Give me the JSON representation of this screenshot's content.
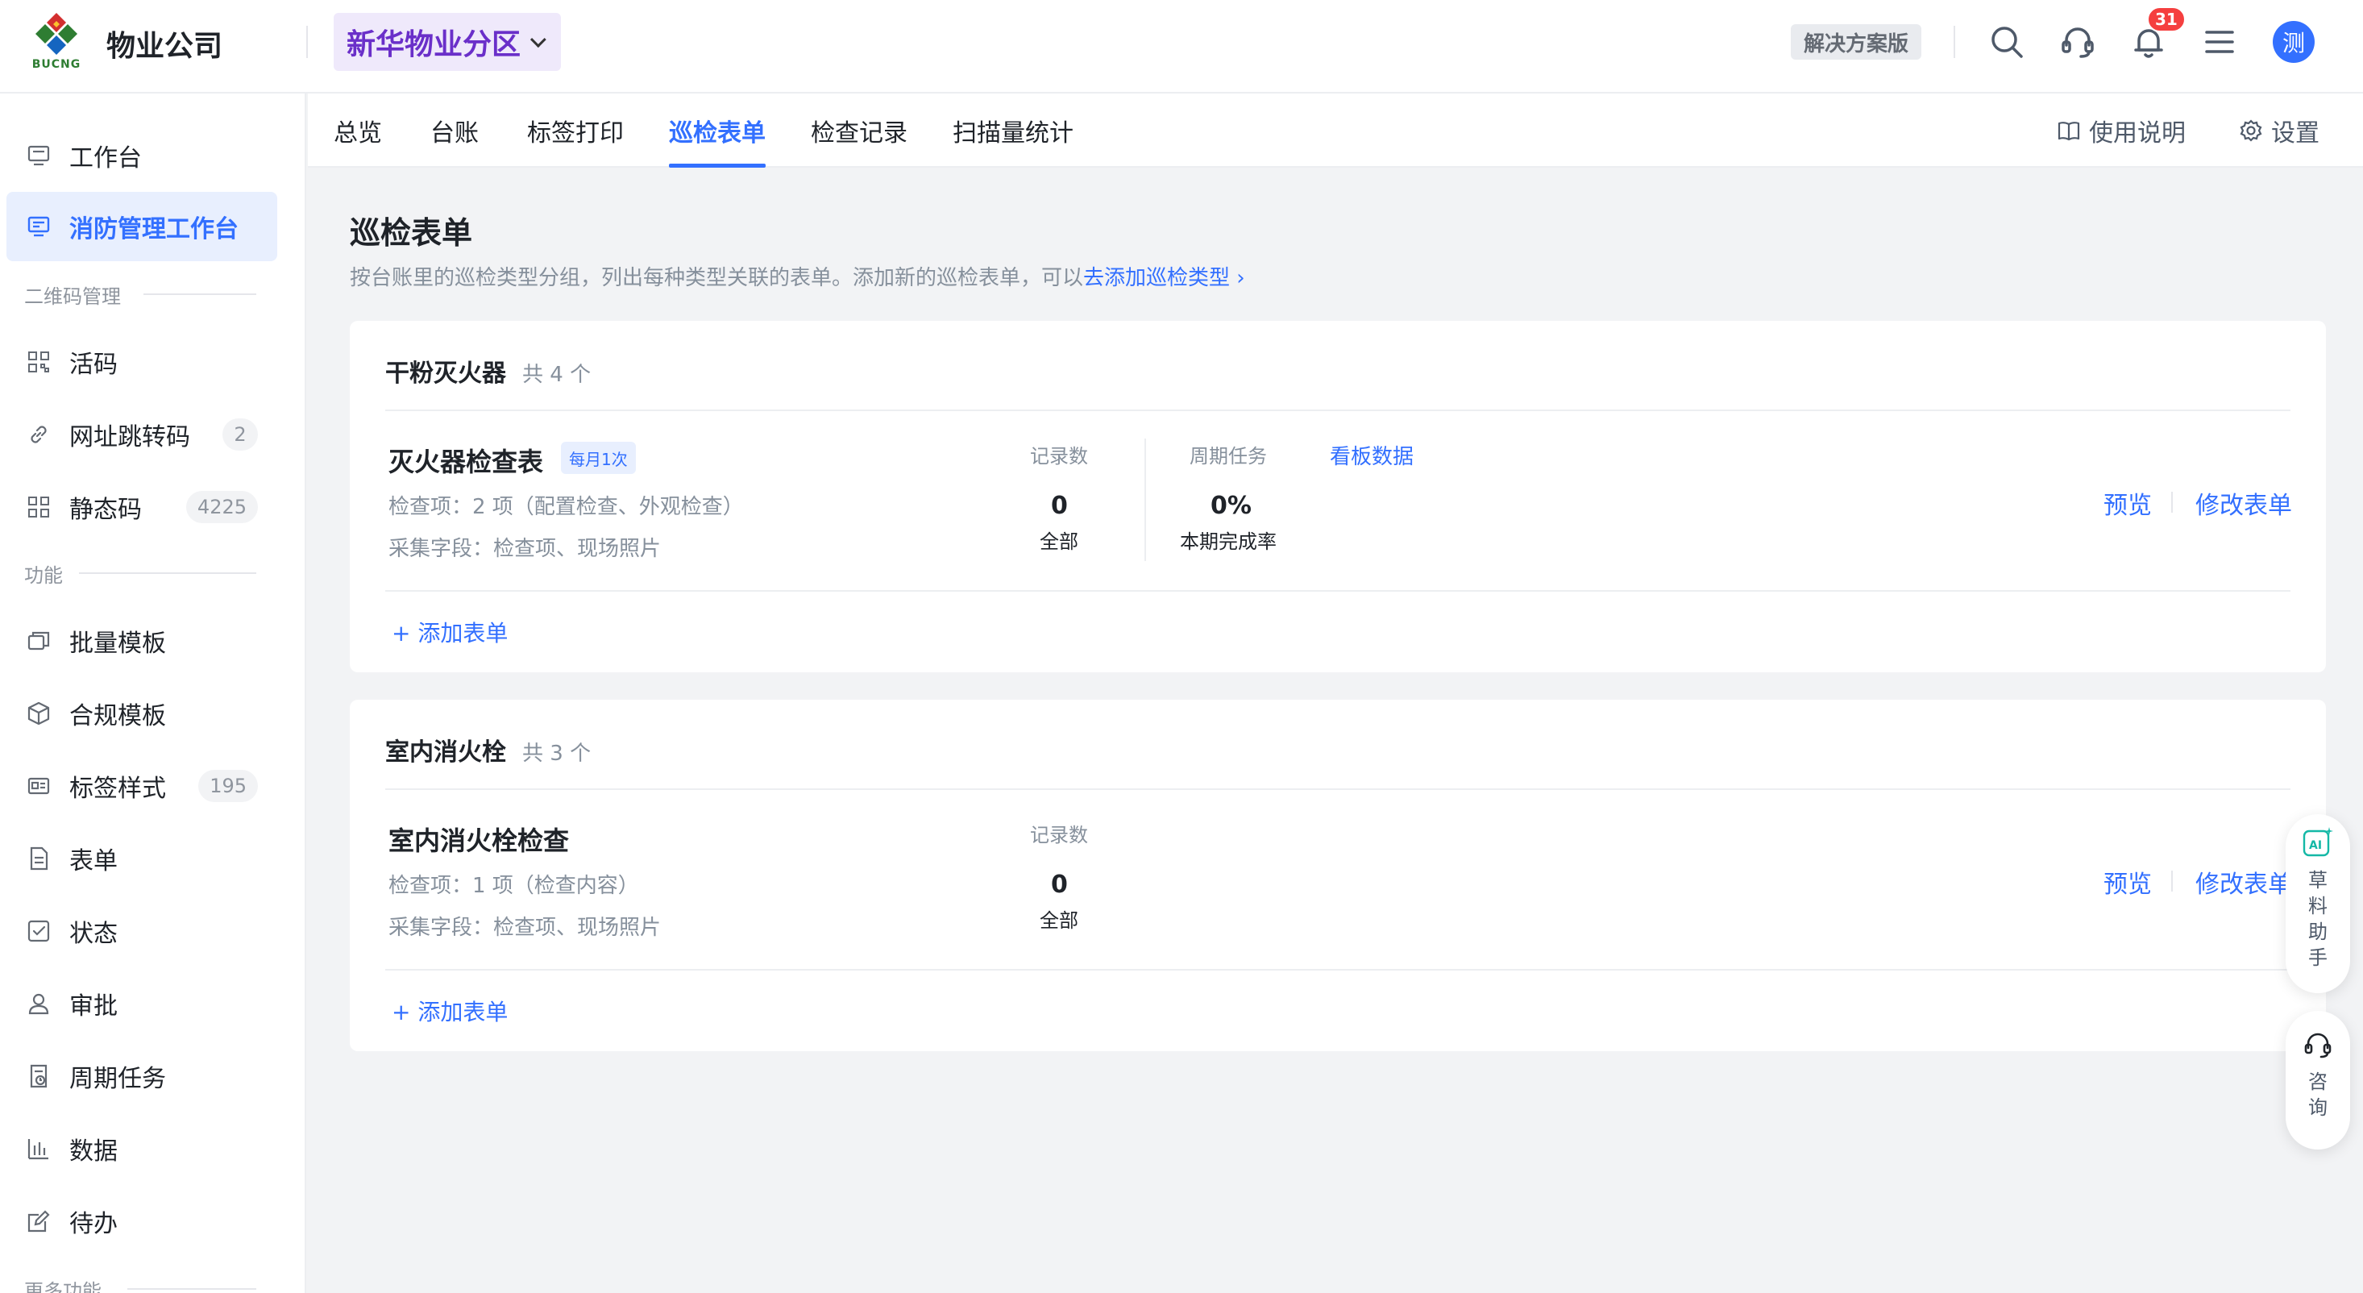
{
  "header": {
    "logo_text": "BUCNG",
    "company": "物业公司",
    "branch": "新华物业分区",
    "edition": "解决方案版",
    "notifications": "31",
    "avatar": "测"
  },
  "sidebar": {
    "items_top": [
      {
        "label": "工作台",
        "icon": "monitor-icon"
      },
      {
        "label": "消防管理工作台",
        "icon": "monitor-icon",
        "active": true
      }
    ],
    "section_qr": "二维码管理",
    "items_qr": [
      {
        "label": "活码",
        "icon": "qr-icon"
      },
      {
        "label": "网址跳转码",
        "icon": "link-icon",
        "count": "2"
      },
      {
        "label": "静态码",
        "icon": "qr-icon",
        "count": "4225"
      }
    ],
    "section_func": "功能",
    "items_func": [
      {
        "label": "批量模板",
        "icon": "layers-icon"
      },
      {
        "label": "合规模板",
        "icon": "cube-icon"
      },
      {
        "label": "标签样式",
        "icon": "id-card-icon",
        "count": "195"
      },
      {
        "label": "表单",
        "icon": "document-icon"
      },
      {
        "label": "状态",
        "icon": "checkbox-icon"
      },
      {
        "label": "审批",
        "icon": "user-icon"
      },
      {
        "label": "周期任务",
        "icon": "calendar-doc-icon"
      },
      {
        "label": "数据",
        "icon": "bar-chart-icon"
      },
      {
        "label": "待办",
        "icon": "edit-icon"
      }
    ],
    "section_more": "更多功能"
  },
  "tabs": [
    {
      "label": "总览"
    },
    {
      "label": "台账"
    },
    {
      "label": "标签打印"
    },
    {
      "label": "巡检表单",
      "active": true
    },
    {
      "label": "检查记录"
    },
    {
      "label": "扫描量统计"
    }
  ],
  "tab_right": {
    "manual": "使用说明",
    "settings": "设置"
  },
  "page": {
    "title": "巡检表单",
    "desc": "按台账里的巡检类型分组，列出每种类型关联的表单。添加新的巡检表单，可以",
    "link": "去添加巡检类型 ›"
  },
  "groups": [
    {
      "name": "干粉灭火器",
      "count": "共 4 个",
      "form": {
        "name": "灭火器检查表",
        "freq": "每月1次",
        "items": "检查项：2 项（配置检查、外观检查）",
        "fields": "采集字段：检查项、现场照片",
        "records_label": "记录数",
        "records_value": "0",
        "records_sub": "全部",
        "periodic_label": "周期任务",
        "periodic_value": "0%",
        "periodic_sub": "本期完成率",
        "dashboard": "看板数据",
        "preview": "预览",
        "edit": "修改表单"
      },
      "add": "+ 添加表单"
    },
    {
      "name": "室内消火栓",
      "count": "共 3 个",
      "form": {
        "name": "室内消火栓检查",
        "items": "检查项：1 项（检查内容）",
        "fields": "采集字段：检查项、现场照片",
        "records_label": "记录数",
        "records_value": "0",
        "records_sub": "全部",
        "preview": "预览",
        "edit": "修改表单"
      },
      "add": "+ 添加表单"
    }
  ],
  "floating": {
    "ai_label": "草料助手",
    "consult_label": "咨询"
  },
  "colors": {
    "accent": "#3370ff",
    "branch_bg": "#efe9fb",
    "branch_text": "#6a2fc9",
    "badge": "#f53f3f"
  }
}
